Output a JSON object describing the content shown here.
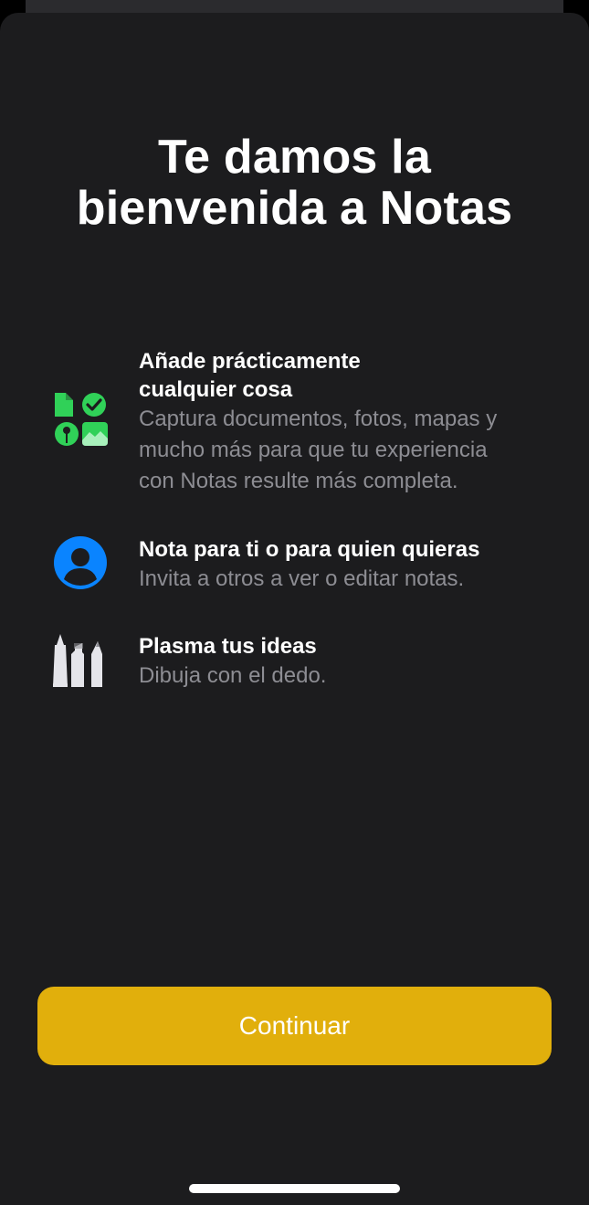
{
  "welcome": {
    "title_line1": "Te damos la",
    "title_line2": "bienvenida a Notas"
  },
  "features": [
    {
      "icon": "attachments-grid-icon",
      "title_line1": "Añade prácticamente",
      "title_line2": "cualquier cosa",
      "desc_line1": "Captura documentos, fotos, mapas y",
      "desc_line2": "mucho más para que tu experiencia",
      "desc_line3": "con Notas resulte más completa."
    },
    {
      "icon": "person-circle-icon",
      "title": "Nota para ti o para quien quieras",
      "desc": "Invita a otros a ver o editar notas."
    },
    {
      "icon": "markup-pens-icon",
      "title": "Plasma tus ideas",
      "desc": "Dibuja con el dedo."
    }
  ],
  "colors": {
    "background": "#1c1c1e",
    "accent": "#e1af0c",
    "green": "#30d158",
    "blue": "#0a84ff",
    "secondary_text": "#8d8d93"
  },
  "button": {
    "label": "Continuar"
  }
}
